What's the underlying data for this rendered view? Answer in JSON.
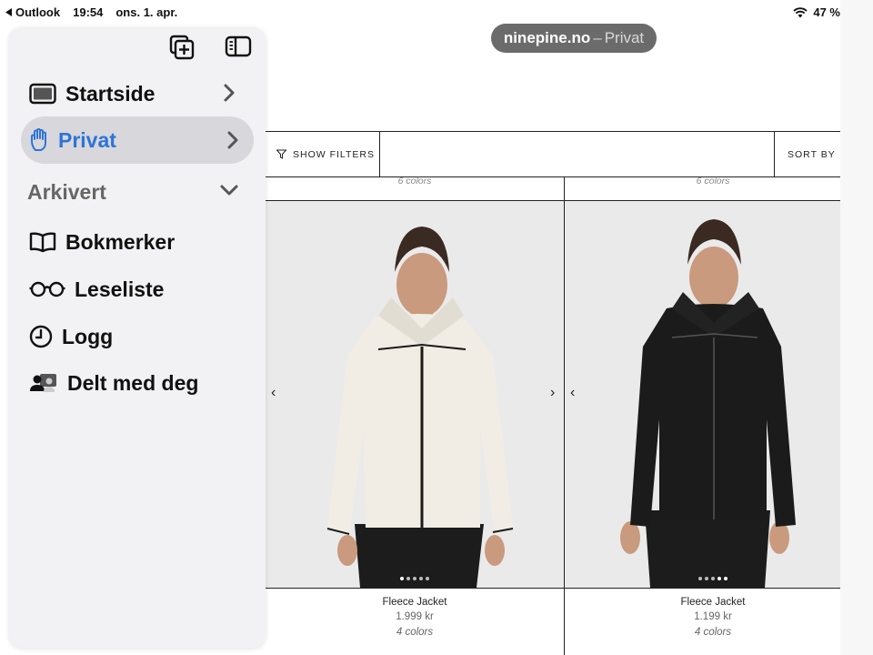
{
  "status_bar": {
    "back_app": "Outlook",
    "time": "19:54",
    "date": "ons. 1. apr.",
    "battery": "47 %",
    "battery_level": 0.47
  },
  "address": {
    "domain": "ninepine.no",
    "separator": "–",
    "mode": "Privat"
  },
  "sidebar": {
    "top_icons": [
      "new-tab-group-icon",
      "sidebar-toggle-icon"
    ],
    "items": [
      {
        "label": "Startside",
        "icon": "tablet-icon"
      },
      {
        "label": "Privat",
        "icon": "hand-icon"
      }
    ],
    "section_title": "Arkivert",
    "archived_items": [
      {
        "label": "Bokmerker",
        "icon": "book-icon"
      },
      {
        "label": "Leseliste",
        "icon": "glasses-icon"
      },
      {
        "label": "Logg",
        "icon": "clock-icon"
      },
      {
        "label": "Delt med deg",
        "icon": "shared-people-icon"
      }
    ],
    "colors": {
      "accent": "#2e74d8"
    }
  },
  "shop": {
    "show_filters": "SHOW FILTERS",
    "sort_by": "SORT BY",
    "top_row_colors": [
      "6 colors",
      "6 colors"
    ],
    "products": [
      {
        "name": "Fleece Jacket",
        "price": "1.999 kr",
        "colors": "4 colors",
        "jacket_color": "#f1ede4"
      },
      {
        "name": "Fleece Jacket",
        "price": "1.199 kr",
        "colors": "4 colors",
        "jacket_color": "#1b1b1b"
      }
    ]
  }
}
